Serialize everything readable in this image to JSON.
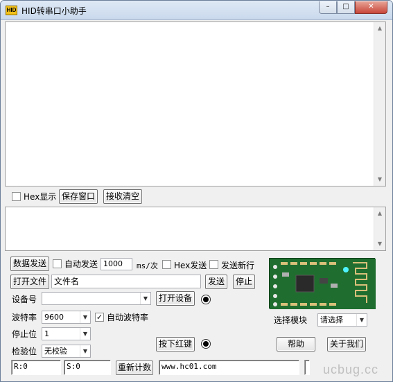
{
  "window": {
    "title": "HID转串口小助手",
    "icon_text": "HID",
    "buttons": {
      "min": "–",
      "max": "□",
      "close": "✕"
    }
  },
  "receive": {
    "hex_display_label": "Hex显示",
    "save_window_label": "保存窗口",
    "clear_receive_label": "接收清空"
  },
  "send": {
    "data_send_label": "数据发送",
    "auto_send_label": "自动发送",
    "interval_value": "1000",
    "interval_unit": "ms/次",
    "hex_send_label": "Hex发送",
    "send_newline_label": "发送新行",
    "open_file_label": "打开文件",
    "file_name_value": "文件名",
    "send_label": "发送",
    "stop_label": "停止"
  },
  "device": {
    "device_no_label": "设备号",
    "device_value": "",
    "open_device_label": "打开设备",
    "baud_label": "波特率",
    "baud_value": "9600",
    "auto_baud_label": "自动波特率",
    "stop_bit_label": "停止位",
    "stop_bit_value": "1",
    "parity_label": "检验位",
    "parity_value": "无校验",
    "press_red_key_label": "按下红键"
  },
  "module": {
    "select_module_label": "选择模块",
    "module_value": "请选择",
    "board_text": "www.hc01.com",
    "help_label": "帮助",
    "about_label": "关于我们"
  },
  "status": {
    "rx": "R:0",
    "tx": "S:0",
    "reset_count_label": "重新计数",
    "url": "www.hc01.com"
  },
  "watermark": "ucbug.cc",
  "colors": {
    "board_green": "#1f6e2f",
    "close_red": "#c7473a",
    "titlebar_blue": "#c9d9ec"
  }
}
